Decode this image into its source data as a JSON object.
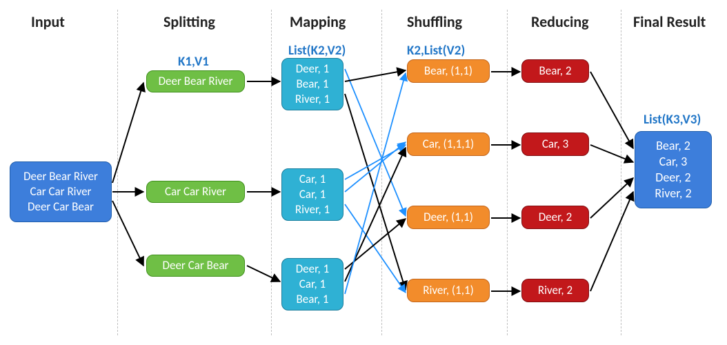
{
  "stages": {
    "input": {
      "title": "Input"
    },
    "split": {
      "title": "Splitting",
      "sub": "K1,V1"
    },
    "map": {
      "title": "Mapping",
      "sub": "List(K2,V2)"
    },
    "shuffle": {
      "title": "Shuffling",
      "sub": "K2,List(V2)"
    },
    "reduce": {
      "title": "Reducing"
    },
    "result": {
      "title": "Final Result",
      "sub": "List(K3,V3)"
    }
  },
  "input_block": "Deer Bear River\nCar Car River\nDeer Car Bear",
  "splits": [
    "Deer Bear River",
    "Car Car River",
    "Deer Car Bear"
  ],
  "maps": [
    "Deer, 1\nBear, 1\nRiver, 1",
    "Car, 1\nCar, 1\nRiver, 1",
    "Deer, 1\nCar, 1\nBear, 1"
  ],
  "shuffles": [
    "Bear, (1,1)",
    "Car, (1,1,1)",
    "Deer, (1,1)",
    "River, (1,1)"
  ],
  "reduces": [
    "Bear, 2",
    "Car, 3",
    "Deer, 2",
    "River, 2"
  ],
  "final_result": "Bear, 2\nCar, 3\nDeer, 2\nRiver, 2"
}
